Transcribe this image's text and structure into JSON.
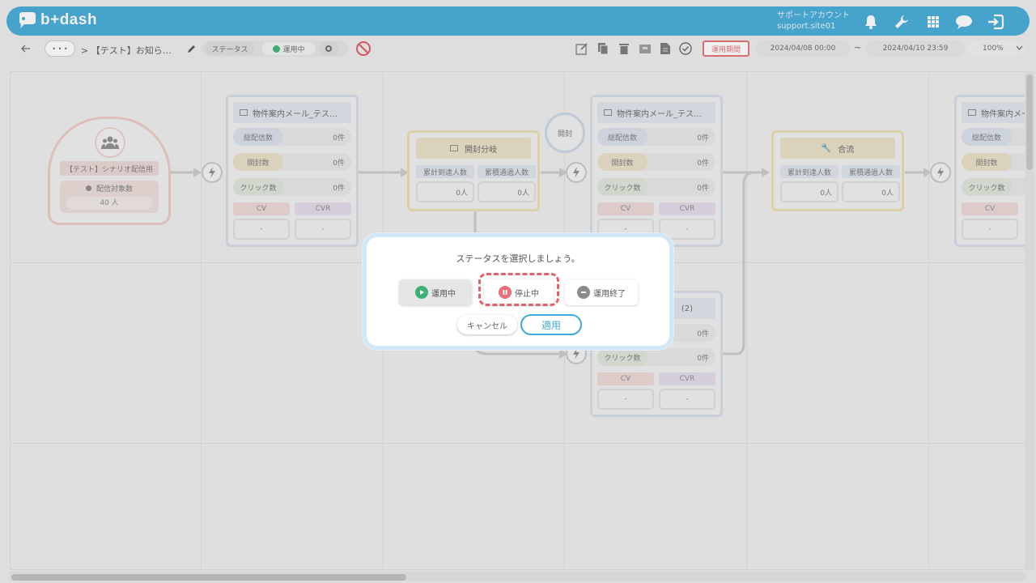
{
  "header": {
    "logo_text": "b+dash",
    "account_line1": "サポートアカウント",
    "account_line2": "support.site01",
    "icons": [
      "bell-icon",
      "wrench-icon",
      "grid-icon",
      "chat-icon",
      "logout-icon"
    ],
    "color": "#3fa9d8"
  },
  "toolbar": {
    "back_icon": "arrow-left-icon",
    "more_label": "• • •",
    "breadcrumb": "> 【テスト】お知ら…",
    "status_label": "ステータス",
    "status_value": "運用中",
    "period_label": "運用期間",
    "start_date": "2024/04/08 00:00",
    "tilde": "~",
    "end_date": "2024/04/10 23:59",
    "zoom": "100%"
  },
  "flow": {
    "start_node": {
      "title": "【テスト】シナリオ配信用",
      "target_label": "配信対象数",
      "target_count": "40 人"
    },
    "mail_nodes": [
      {
        "title": "物件案内メール_テス…",
        "metrics": [
          {
            "label": "総配信数",
            "value": "0件"
          },
          {
            "label": "開封数",
            "value": "0件"
          },
          {
            "label": "クリック数",
            "value": "0件"
          }
        ],
        "cv_label": "CV",
        "cvr_label": "CVR",
        "cv": "-",
        "cvr": "-"
      },
      {
        "title": "物件案内メール_テス…",
        "metrics": [
          {
            "label": "総配信数",
            "value": "0件"
          },
          {
            "label": "開封数",
            "value": "0件"
          },
          {
            "label": "クリック数",
            "value": "0件"
          }
        ],
        "cv_label": "CV",
        "cvr_label": "CVR",
        "cv": "-",
        "cvr": "-"
      },
      {
        "title": "物件案内メール_テス",
        "metrics": [
          {
            "label": "総配信数",
            "value": ""
          },
          {
            "label": "開封数",
            "value": ""
          },
          {
            "label": "クリック数",
            "value": ""
          }
        ],
        "cv_label": "CV",
        "cvr_label": "",
        "cv": "-",
        "cvr": ""
      }
    ],
    "lower_node": {
      "title_suffix": "(2)",
      "metric1": "0件",
      "click_label": "クリック数",
      "click_value": "0件",
      "cv_label": "CV",
      "cvr_label": "CVR",
      "cv": "-",
      "cvr": "-"
    },
    "branch_open": {
      "title": "開封分岐",
      "col1": "累計到達人数",
      "col2": "累積通過人数",
      "val1": "0人",
      "val2": "0人"
    },
    "branch_merge": {
      "title": "合流",
      "col1": "累計到達人数",
      "col2": "累積通過人数",
      "val1": "0人",
      "val2": "0人"
    },
    "open_bubble": "開封"
  },
  "modal": {
    "title": "ステータスを選択しましょう。",
    "options": [
      {
        "label": "運用中",
        "color": "#3bb273",
        "icon": "play-icon"
      },
      {
        "label": "停止中",
        "color": "#e8727c",
        "icon": "pause-icon"
      },
      {
        "label": "運用終了",
        "color": "#8a8a8a",
        "icon": "minus-icon"
      }
    ],
    "cancel_label": "キャンセル",
    "apply_label": "適用"
  }
}
